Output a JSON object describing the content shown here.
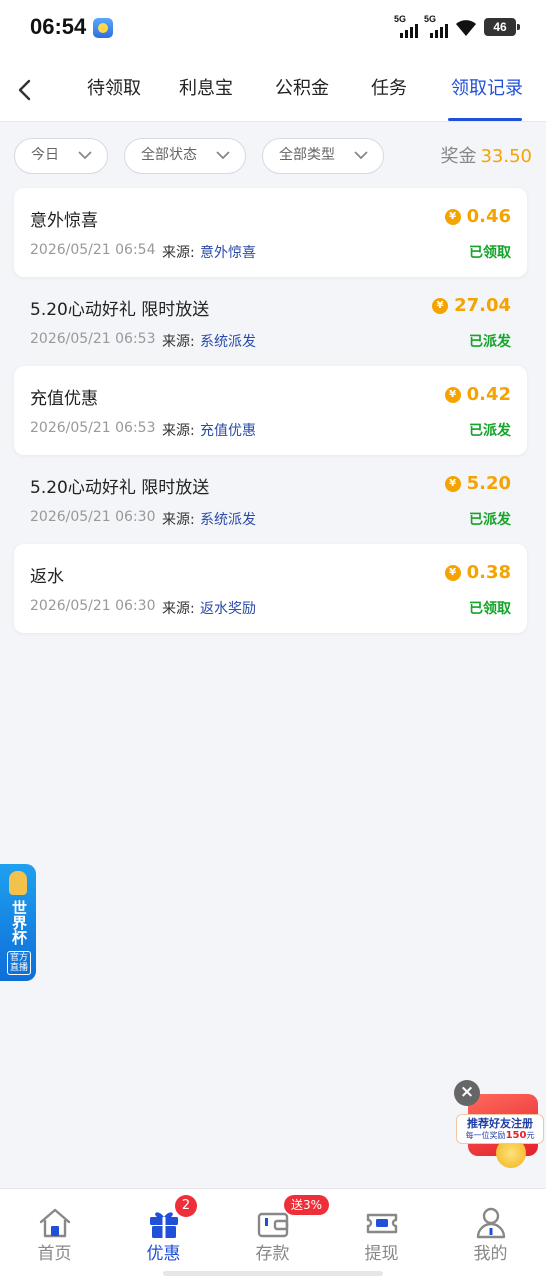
{
  "status_bar": {
    "time": "06:54",
    "signal1_label": "5G",
    "signal2_label": "5G",
    "battery": "46"
  },
  "header": {
    "tabs": [
      {
        "label": "待领取"
      },
      {
        "label": "利息宝"
      },
      {
        "label": "公积金"
      },
      {
        "label": "任务"
      },
      {
        "label": "领取记录",
        "active": true
      }
    ]
  },
  "filters": {
    "date": "今日",
    "status": "全部状态",
    "type": "全部类型",
    "bonus_label": "奖金",
    "bonus_amount": "33.50"
  },
  "records": [
    {
      "title": "意外惊喜",
      "time": "2026/05/21 06:54",
      "source_label": "来源:",
      "source": "意外惊喜",
      "amount": "0.46",
      "status": "已领取"
    },
    {
      "title": "5.20心动好礼 限时放送",
      "time": "2026/05/21 06:53",
      "source_label": "来源:",
      "source": "系统派发",
      "amount": "27.04",
      "status": "已派发"
    },
    {
      "title": "充值优惠",
      "time": "2026/05/21 06:53",
      "source_label": "来源:",
      "source": "充值优惠",
      "amount": "0.42",
      "status": "已派发"
    },
    {
      "title": "5.20心动好礼 限时放送",
      "time": "2026/05/21 06:30",
      "source_label": "来源:",
      "source": "系统派发",
      "amount": "5.20",
      "status": "已派发"
    },
    {
      "title": "返水",
      "time": "2026/05/21 06:30",
      "source_label": "来源:",
      "source": "返水奖励",
      "amount": "0.38",
      "status": "已领取"
    }
  ],
  "currency_symbol": "¥",
  "side_tab": {
    "title": "世界杯",
    "subtitle": "官方直播"
  },
  "referral": {
    "line1": "推荐好友注册",
    "line2_prefix": "每一位奖励",
    "line2_amount": "150",
    "line2_suffix": "元"
  },
  "bottom_nav": {
    "items": [
      {
        "label": "首页",
        "icon": "home-icon"
      },
      {
        "label": "优惠",
        "icon": "gift-icon",
        "badge": "2",
        "active": true
      },
      {
        "label": "存款",
        "icon": "wallet-icon",
        "badge": "送3%"
      },
      {
        "label": "提现",
        "icon": "withdraw-icon"
      },
      {
        "label": "我的",
        "icon": "user-icon"
      }
    ]
  },
  "colors": {
    "primary": "#2150d8",
    "amount": "#f5a300",
    "status_green": "#14a42a",
    "badge_red": "#ee2f3a"
  }
}
